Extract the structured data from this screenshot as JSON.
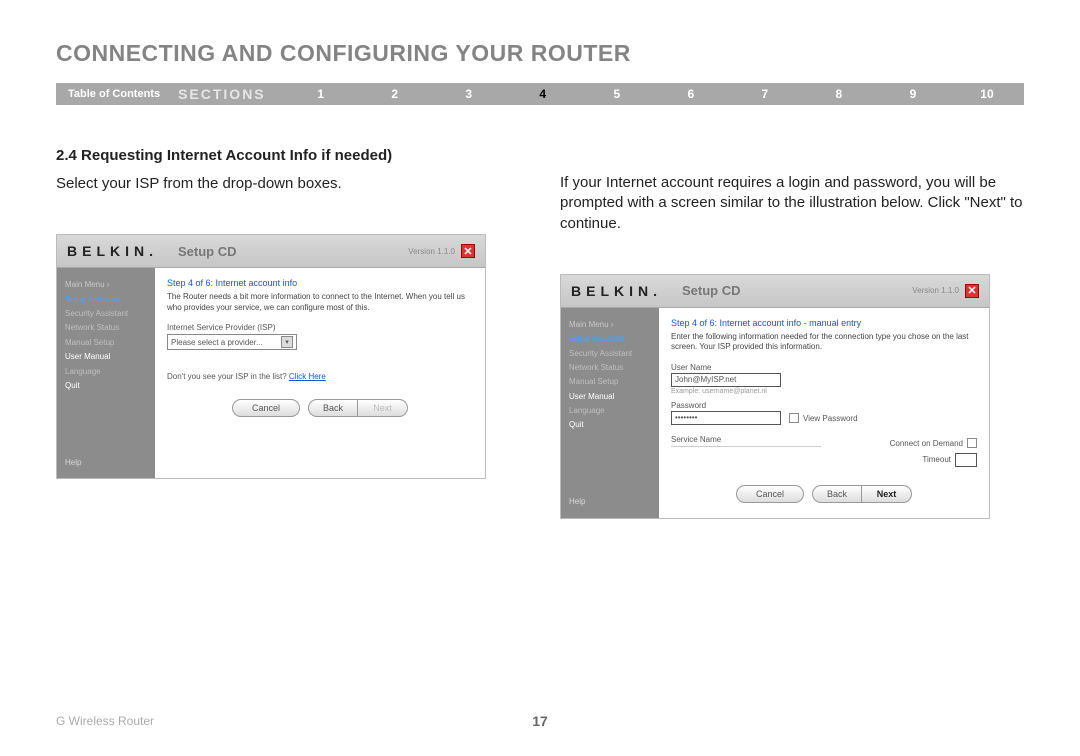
{
  "header": {
    "title": "CONNECTING AND CONFIGURING YOUR ROUTER"
  },
  "navbar": {
    "toc": "Table of Contents",
    "sections_label": "SECTIONS",
    "items": [
      "1",
      "2",
      "3",
      "4",
      "5",
      "6",
      "7",
      "8",
      "9",
      "10"
    ],
    "current": "4"
  },
  "left_col": {
    "subhead": "2.4 Requesting Internet Account Info if needed)",
    "body": "Select your ISP from the drop-down boxes."
  },
  "right_col": {
    "body": "If your Internet account requires a login and password, you will be prompted with a screen similar to the illustration below. Click \"Next\" to continue."
  },
  "screenshot_common": {
    "logo": "BELKIN.",
    "title": "Setup CD",
    "version": "Version 1.1.0",
    "sidebar": {
      "main_menu": "Main Menu  ›",
      "items": [
        "Setup Assistant",
        "Security Assistant",
        "Network Status",
        "Manual Setup",
        "User Manual",
        "Language",
        "Quit"
      ],
      "help": "Help"
    },
    "buttons": {
      "cancel": "Cancel",
      "back": "Back",
      "next": "Next"
    }
  },
  "sc1": {
    "step": "Step 4 of 6: Internet account info",
    "desc": "The Router needs a bit more information to connect to the Internet. When you tell us who provides your service, we can configure most of this.",
    "isp_label": "Internet Service Provider (ISP)",
    "isp_value": "Please select a provider...",
    "footnote_pre": "Don't you see your ISP in the list? ",
    "footnote_link": "Click Here"
  },
  "sc2": {
    "step": "Step 4 of 6: Internet account info - manual entry",
    "desc": "Enter the following information needed for the connection type you chose on the last screen. Your ISP provided this information.",
    "user_label": "User Name",
    "user_value": "John@MyISP.net",
    "user_hint": "Example: username@planet.nl",
    "pass_label": "Password",
    "pass_value": "••••••••",
    "view_pass": "View Password",
    "service_label": "Service Name",
    "cod": "Connect on Demand",
    "timeout": "Timeout"
  },
  "footer": {
    "product": "G Wireless Router",
    "page": "17"
  }
}
